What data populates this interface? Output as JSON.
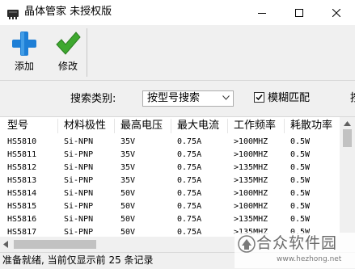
{
  "window": {
    "title": "晶体管家 未授权版",
    "controls": [
      "minimize",
      "maximize",
      "close"
    ]
  },
  "toolbar": {
    "add_label": "添加",
    "edit_label": "修改",
    "add_icon": "plus-icon",
    "edit_icon": "checkmark-icon",
    "colors": {
      "add": "#1e7fd6",
      "edit": "#3ea82f"
    }
  },
  "search": {
    "category_label": "搜索类别:",
    "category_value": "按型号搜索",
    "fuzzy_label": "模糊匹配",
    "fuzzy_checked": true,
    "clipped_label": "按"
  },
  "table": {
    "columns": [
      "型号",
      "材料极性",
      "最高电压",
      "最大电流",
      "工作频率",
      "耗散功率"
    ],
    "rows": [
      [
        "HS5810",
        "Si-NPN",
        "35V",
        "0.75A",
        ">100MHZ",
        "0.5W"
      ],
      [
        "HS5811",
        "Si-PNP",
        "35V",
        "0.75A",
        ">100MHZ",
        "0.5W"
      ],
      [
        "HS5812",
        "Si-NPN",
        "35V",
        "0.75A",
        ">135MHZ",
        "0.5W"
      ],
      [
        "HS5813",
        "Si-PNP",
        "35V",
        "0.75A",
        ">135MHZ",
        "0.5W"
      ],
      [
        "HS5814",
        "Si-NPN",
        "50V",
        "0.75A",
        ">100MHZ",
        "0.5W"
      ],
      [
        "HS5815",
        "Si-PNP",
        "50V",
        "0.75A",
        ">100MHZ",
        "0.5W"
      ],
      [
        "HS5816",
        "Si-NPN",
        "50V",
        "0.75A",
        ">135MHZ",
        "0.5W"
      ],
      [
        "HS5817",
        "Si-PNP",
        "50V",
        "0.75A",
        ">135MHZ",
        "0.5W"
      ]
    ]
  },
  "status": {
    "text": "准备就绪, 当前仅显示前 25 条记录"
  },
  "watermark": {
    "title": "合众软件园",
    "url": "www.hezhong.net"
  }
}
